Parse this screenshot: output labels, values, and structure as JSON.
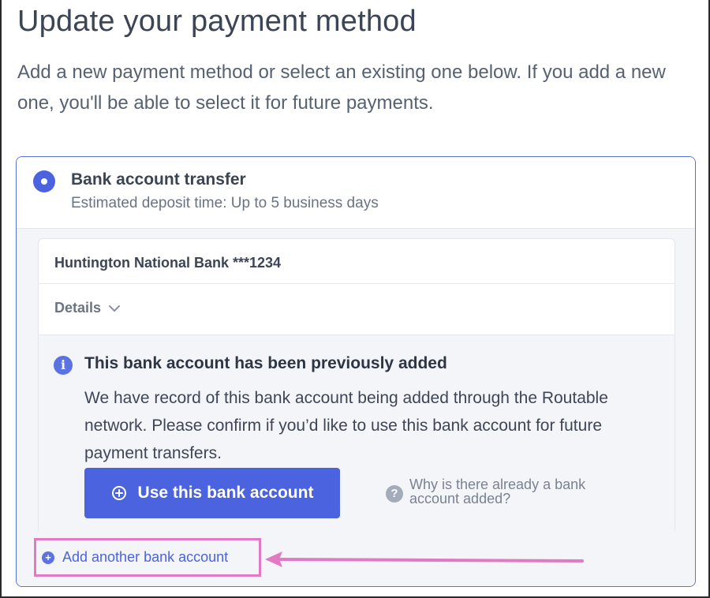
{
  "page": {
    "title": "Update your payment method",
    "description": "Add a new payment method or select an existing one below. If you add a new one, you'll be able to select it for future payments."
  },
  "payment_method": {
    "selected": true,
    "title": "Bank account transfer",
    "subtitle": "Estimated deposit time: Up to 5 business days"
  },
  "bank": {
    "name": "Huntington National Bank ***1234",
    "details_label": "Details"
  },
  "notice": {
    "icon": "info-icon",
    "title": "This bank account has been previously added",
    "text": "We have record of this bank account being added through the Routable network. Please confirm if you’d like to use this bank account for future payment transfers."
  },
  "actions": {
    "use_button": "Use this bank account",
    "why_link": "Why is there already a bank account added?",
    "add_link": "Add another bank account"
  },
  "colors": {
    "accent": "#4c63e0",
    "highlight": "#e27ac3",
    "title_text": "#3b4556",
    "muted_text": "#6a7383"
  }
}
